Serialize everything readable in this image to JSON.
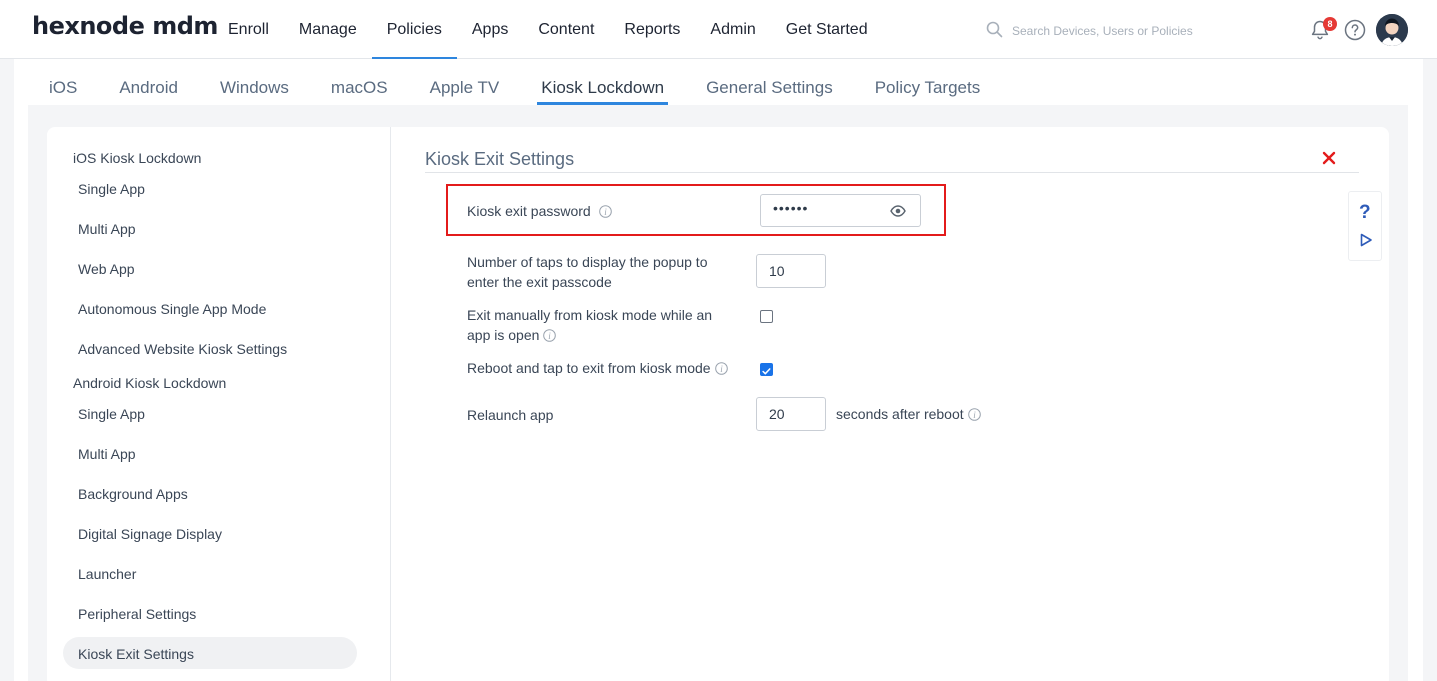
{
  "app": {
    "logo": "hexnode mdm"
  },
  "nav": {
    "items": [
      {
        "label": "Enroll"
      },
      {
        "label": "Manage"
      },
      {
        "label": "Policies",
        "active": true
      },
      {
        "label": "Apps"
      },
      {
        "label": "Content"
      },
      {
        "label": "Reports"
      },
      {
        "label": "Admin"
      },
      {
        "label": "Get Started"
      }
    ]
  },
  "search": {
    "placeholder": "Search Devices, Users or Policies"
  },
  "notifications": {
    "count": "8"
  },
  "tabs": [
    {
      "label": "iOS"
    },
    {
      "label": "Android"
    },
    {
      "label": "Windows"
    },
    {
      "label": "macOS"
    },
    {
      "label": "Apple TV"
    },
    {
      "label": "Kiosk Lockdown",
      "active": true
    },
    {
      "label": "General Settings"
    },
    {
      "label": "Policy Targets"
    }
  ],
  "sidebar": {
    "items": [
      {
        "label": "iOS Kiosk Lockdown",
        "type": "group"
      },
      {
        "label": "Single App",
        "type": "sub"
      },
      {
        "label": "Multi App",
        "type": "sub"
      },
      {
        "label": "Web App",
        "type": "sub"
      },
      {
        "label": "Autonomous Single App Mode",
        "type": "sub"
      },
      {
        "label": "Advanced Website Kiosk Settings",
        "type": "sub"
      },
      {
        "label": "Android Kiosk Lockdown",
        "type": "group"
      },
      {
        "label": "Single App",
        "type": "sub"
      },
      {
        "label": "Multi App",
        "type": "sub"
      },
      {
        "label": "Background Apps",
        "type": "sub"
      },
      {
        "label": "Digital Signage Display",
        "type": "sub"
      },
      {
        "label": "Launcher",
        "type": "sub"
      },
      {
        "label": "Peripheral Settings",
        "type": "sub"
      },
      {
        "label": "Kiosk Exit Settings",
        "type": "sub",
        "active": true
      }
    ]
  },
  "panel": {
    "title": "Kiosk Exit Settings",
    "password": {
      "label": "Kiosk exit password",
      "masked_value": "••••••"
    },
    "taps": {
      "label_line1": "Number of taps to display the popup to",
      "label_line2": "enter the exit passcode",
      "value": "10"
    },
    "exit_manually": {
      "label_line1": "Exit manually from kiosk mode while an",
      "label_line2": "app is open",
      "checked": false
    },
    "reboot_tap": {
      "label": "Reboot and tap to exit from kiosk mode",
      "checked": true
    },
    "relaunch": {
      "label": "Relaunch app",
      "value": "20",
      "suffix": "seconds after reboot"
    }
  },
  "help": {
    "question": "?"
  },
  "colors": {
    "accent": "#2e86de",
    "highlight": "#e31b1b",
    "checkbox": "#1a73e8",
    "close": "#e31b1b"
  }
}
